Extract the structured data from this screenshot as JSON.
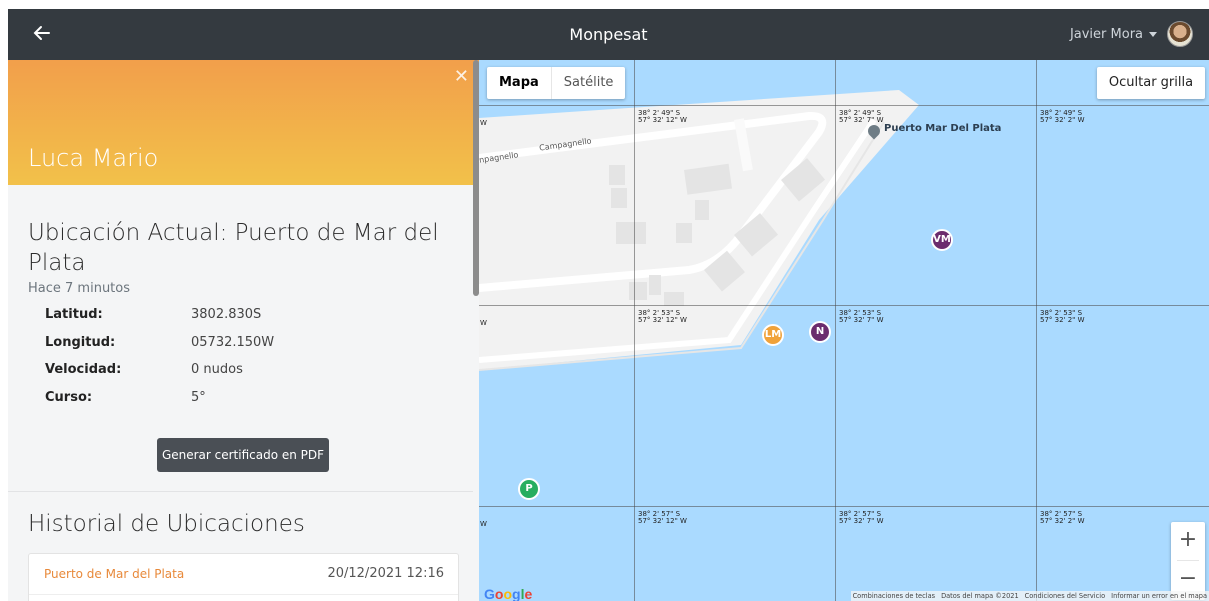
{
  "app": {
    "title": "Monpesat",
    "user_name": "Javier Mora"
  },
  "vessel": {
    "name": "Luca Mario",
    "location_title": "Ubicación Actual: Puerto de Mar del Plata",
    "time_ago": "Hace 7 minutos",
    "fields": [
      {
        "label": "Latitud:",
        "value": "3802.830S"
      },
      {
        "label": "Longitud:",
        "value": "05732.150W"
      },
      {
        "label": "Velocidad:",
        "value": "0 nudos"
      },
      {
        "label": "Curso:",
        "value": "5°"
      }
    ],
    "pdf_button": "Generar certificado en PDF"
  },
  "history": {
    "title": "Historial de Ubicaciones",
    "items": [
      {
        "place": "Puerto de Mar del Plata",
        "date": "20/12/2021 12:16"
      }
    ]
  },
  "map": {
    "type_map": "Mapa",
    "type_satellite": "Satélite",
    "grid_button": "Ocultar grilla",
    "poi_label": "Puerto Mar Del Plata",
    "street_1": "Campagnello",
    "street_2": "npagnello",
    "coords": {
      "r1c1": "38° 2' 49\" S\n57° 32' 12\" W",
      "r1c2": "38° 2' 49\" S\n57° 32' 7\" W",
      "r1c3": "38° 2' 49\" S\n57° 32' 2\" W",
      "r2c1": "38° 2' 53\" S\n57° 32' 12\" W",
      "r2c2": "38° 2' 53\" S\n57° 32' 7\" W",
      "r2c3": "38° 2' 53\" S\n57° 32' 2\" W",
      "r3c1": "38° 2' 57\" S\n57° 32' 12\" W",
      "r3c2": "38° 2' 57\" S\n57° 32' 7\" W",
      "r3c3": "38° 2' 57\" S\n57° 32' 2\" W"
    },
    "edge_w": "W",
    "markers": {
      "vm": {
        "label": "VM",
        "color": "#6b2c6e"
      },
      "lm": {
        "label": "LM",
        "color": "#f0a23a"
      },
      "n": {
        "label": "N",
        "color": "#6b2c6e"
      },
      "p": {
        "label": "P",
        "color": "#27ae60"
      }
    },
    "zoom_in": "+",
    "zoom_out": "−",
    "google": "Google",
    "attribution": {
      "shortcuts": "Combinaciones de teclas",
      "data": "Datos del mapa ©2021",
      "terms": "Condiciones del Servicio",
      "report": "Informar un error en el mapa"
    }
  },
  "colors": {
    "navbar": "#343a40",
    "header_gradient_top": "#f29f4b",
    "header_gradient_bottom": "#f2c14a",
    "water": "#aadaff",
    "accent_link": "#e8893a"
  }
}
